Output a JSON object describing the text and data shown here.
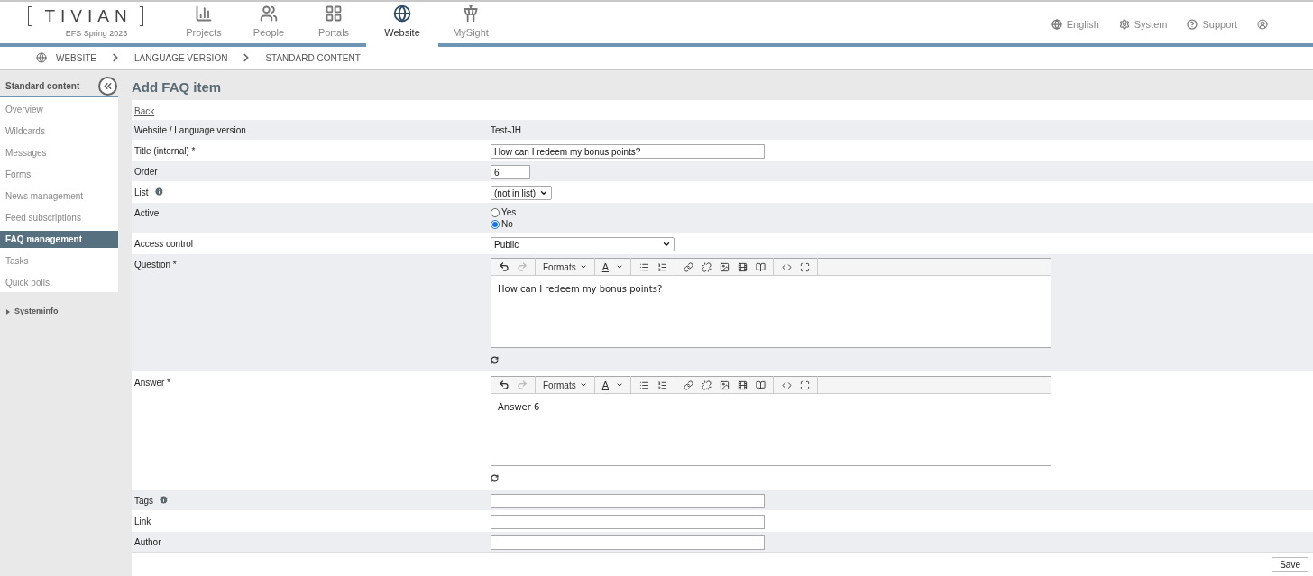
{
  "header": {
    "logo": "TIVIAN",
    "edition": "EFS Spring 2023",
    "nav": [
      {
        "label": "Projects",
        "selected": false
      },
      {
        "label": "People",
        "selected": false
      },
      {
        "label": "Portals",
        "selected": false
      },
      {
        "label": "Website",
        "selected": true
      },
      {
        "label": "MySight",
        "selected": false
      }
    ],
    "utilities": [
      "English",
      "System",
      "Support"
    ]
  },
  "breadcrumb": [
    "WEBSITE",
    "LANGUAGE VERSION",
    "STANDARD CONTENT"
  ],
  "sidebar": {
    "title": "Standard content",
    "items": [
      {
        "label": "Overview",
        "selected": false
      },
      {
        "label": "Wildcards",
        "selected": false
      },
      {
        "label": "Messages",
        "selected": false
      },
      {
        "label": "Forms",
        "selected": false
      },
      {
        "label": "News management",
        "selected": false
      },
      {
        "label": "Feed subscriptions",
        "selected": false
      },
      {
        "label": "FAQ management",
        "selected": true
      },
      {
        "label": "Tasks",
        "selected": false
      },
      {
        "label": "Quick polls",
        "selected": false
      }
    ],
    "sections": [
      {
        "label": "Systeminfo",
        "expanded": false
      }
    ]
  },
  "page": {
    "title": "Add FAQ item",
    "back": "Back",
    "rows": [
      {
        "kind": "text",
        "label": "Website / Language version",
        "value": "Test-JH"
      },
      {
        "kind": "input",
        "label": "Title (internal) *",
        "value": "How can I redeem my bonus points?"
      },
      {
        "kind": "short_input",
        "label": "Order",
        "value": "6"
      },
      {
        "kind": "short_select",
        "label": "List",
        "info": true,
        "value": "(not in list)"
      },
      {
        "kind": "radio",
        "label": "Active",
        "options": [
          {
            "label": "Yes",
            "selected": false
          },
          {
            "label": "No",
            "selected": true
          }
        ]
      },
      {
        "kind": "select",
        "label": "Access control",
        "value": "Public"
      },
      {
        "kind": "editor",
        "label": "Question *",
        "formats": "Formats",
        "text_color_button": "A",
        "value": "How can I redeem my bonus points?"
      },
      {
        "kind": "editor",
        "label": "Answer *",
        "formats": "Formats",
        "text_color_button": "A",
        "value": "Answer 6"
      },
      {
        "kind": "input",
        "label": "Tags",
        "info": true
      },
      {
        "kind": "input",
        "label": "Link"
      },
      {
        "kind": "input",
        "label": "Author"
      }
    ],
    "save": "Save"
  }
}
